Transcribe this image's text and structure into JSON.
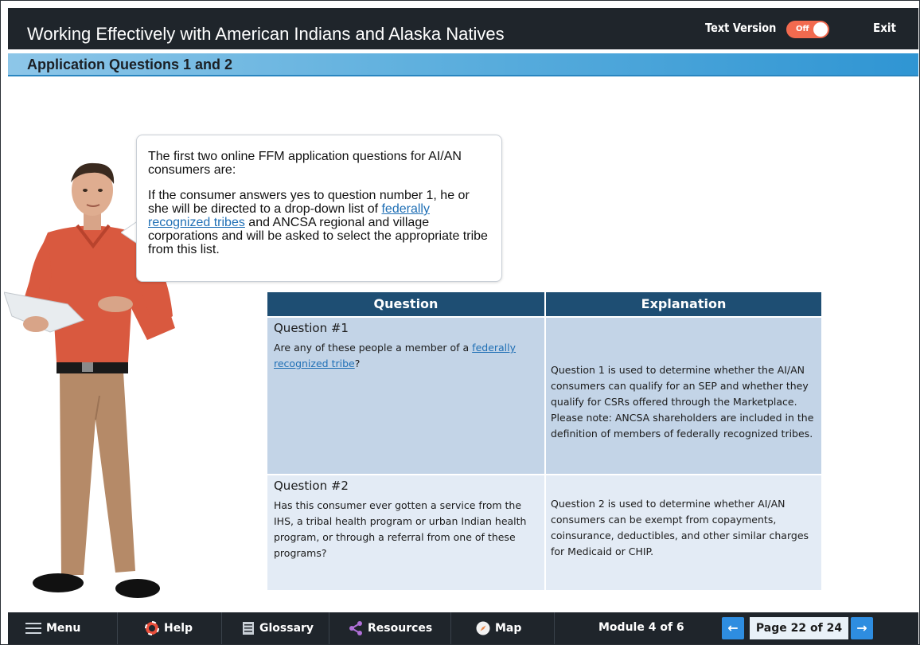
{
  "header": {
    "title": "Working Effectively with American Indians and Alaska Natives",
    "text_version_label": "Text Version",
    "toggle_state": "Off",
    "exit_label": "Exit"
  },
  "page": {
    "subtitle": "Application Questions 1 and 2"
  },
  "bubble": {
    "intro": "The first two online FFM application questions for AI/AN consumers are:",
    "body_before_link": "If the consumer answers yes to question number 1, he or she will be directed to a drop-down list of ",
    "body_link": "federally recognized tribes",
    "body_after_link": " and ANCSA regional and village corporations and will be asked to select the appropriate tribe from this list."
  },
  "table": {
    "headers": [
      "Question",
      "Explanation"
    ],
    "rows": [
      {
        "title": "Question #1",
        "text_before_link": "Are any of these people a member of a ",
        "link": "federally recognized tribe",
        "text_after_link": "?",
        "explanation": "Question 1 is used to determine whether the AI/AN consumers can qualify for an SEP and whether they qualify for CSRs offered through the Marketplace. Please note: ANCSA shareholders are included in the definition of members of federally recognized tribes."
      },
      {
        "title": "Question #2",
        "text": "Has this consumer ever gotten a service from the IHS, a tribal health program or urban Indian health program, or through a referral from one of these programs?",
        "explanation": "Question 2 is used to determine whether AI/AN consumers can be exempt from copayments, coinsurance, deductibles, and other similar charges for Medicaid or CHIP."
      }
    ]
  },
  "footer": {
    "menu": "Menu",
    "help": "Help",
    "glossary": "Glossary",
    "resources": "Resources",
    "map": "Map",
    "module": "Module 4 of 6",
    "page": "Page 22 of 24",
    "prev_arrow": "←",
    "next_arrow": "→"
  },
  "colors": {
    "header_bg": "#1f252b",
    "subbar_accent": "#2f95d3",
    "table_header": "#1e4e73",
    "row1_bg": "#c3d4e7",
    "row2_bg": "#e3ebf5",
    "toggle_off": "#f26a4f",
    "nav_button": "#2e8de0"
  }
}
